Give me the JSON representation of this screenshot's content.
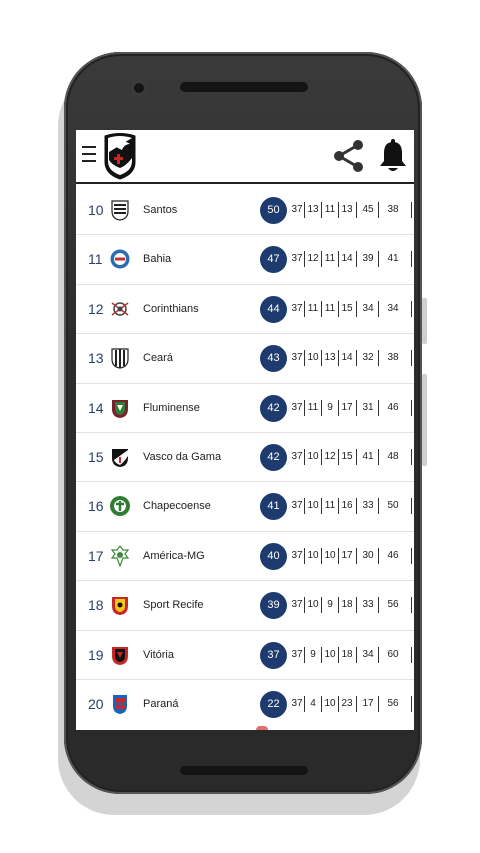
{
  "header": {
    "menu_icon": "hamburger-menu-icon",
    "logo_icon": "vasco-da-gama-crest-icon",
    "share_icon": "share-icon",
    "notification_icon": "bell-icon"
  },
  "colors": {
    "points_badge": "#1d3b6e",
    "position_text": "#2a3f6b",
    "divider": "#222222"
  },
  "standings": [
    {
      "pos": "10",
      "team": "Santos",
      "pts": "50",
      "stats": [
        "37",
        "13",
        "11",
        "13",
        "45",
        "38"
      ],
      "icon": "santos-crest-icon"
    },
    {
      "pos": "11",
      "team": "Bahia",
      "pts": "47",
      "stats": [
        "37",
        "12",
        "11",
        "14",
        "39",
        "41"
      ],
      "icon": "bahia-crest-icon"
    },
    {
      "pos": "12",
      "team": "Corinthians",
      "pts": "44",
      "stats": [
        "37",
        "11",
        "11",
        "15",
        "34",
        "34"
      ],
      "icon": "corinthians-crest-icon"
    },
    {
      "pos": "13",
      "team": "Ceará",
      "pts": "43",
      "stats": [
        "37",
        "10",
        "13",
        "14",
        "32",
        "38"
      ],
      "icon": "ceara-crest-icon"
    },
    {
      "pos": "14",
      "team": "Fluminense",
      "pts": "42",
      "stats": [
        "37",
        "11",
        "9",
        "17",
        "31",
        "46"
      ],
      "icon": "fluminense-crest-icon"
    },
    {
      "pos": "15",
      "team": "Vasco da Gama",
      "pts": "42",
      "stats": [
        "37",
        "10",
        "12",
        "15",
        "41",
        "48"
      ],
      "icon": "vasco-crest-icon"
    },
    {
      "pos": "16",
      "team": "Chapecoense",
      "pts": "41",
      "stats": [
        "37",
        "10",
        "11",
        "16",
        "33",
        "50"
      ],
      "icon": "chapecoense-crest-icon"
    },
    {
      "pos": "17",
      "team": "América-MG",
      "pts": "40",
      "stats": [
        "37",
        "10",
        "10",
        "17",
        "30",
        "46"
      ],
      "icon": "america-mg-crest-icon"
    },
    {
      "pos": "18",
      "team": "Sport Recife",
      "pts": "39",
      "stats": [
        "37",
        "10",
        "9",
        "18",
        "33",
        "56"
      ],
      "icon": "sport-recife-crest-icon"
    },
    {
      "pos": "19",
      "team": "Vitória",
      "pts": "37",
      "stats": [
        "37",
        "9",
        "10",
        "18",
        "34",
        "60"
      ],
      "icon": "vitoria-crest-icon"
    },
    {
      "pos": "20",
      "team": "Paraná",
      "pts": "22",
      "stats": [
        "37",
        "4",
        "10",
        "23",
        "17",
        "56"
      ],
      "icon": "parana-crest-icon"
    }
  ]
}
